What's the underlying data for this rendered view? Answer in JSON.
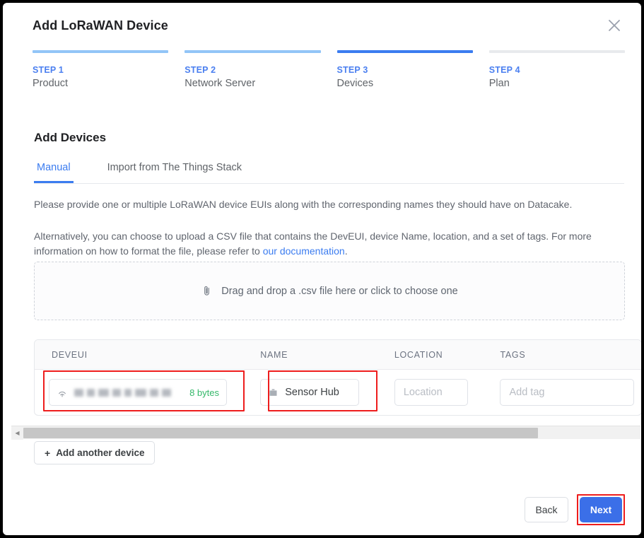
{
  "modal": {
    "title": "Add LoRaWAN Device",
    "close_icon": "close-icon"
  },
  "stepper": {
    "steps": [
      {
        "num": "STEP 1",
        "label": "Product",
        "state": "done"
      },
      {
        "num": "STEP 2",
        "label": "Network Server",
        "state": "done"
      },
      {
        "num": "STEP 3",
        "label": "Devices",
        "state": "active"
      },
      {
        "num": "STEP 4",
        "label": "Plan",
        "state": "inactive"
      }
    ]
  },
  "section": {
    "title": "Add Devices",
    "tabs": [
      {
        "label": "Manual",
        "active": true
      },
      {
        "label": "Import from The Things Stack",
        "active": false
      }
    ],
    "paragraph1": "Please provide one or multiple LoRaWAN device EUIs along with the corresponding names they should have on Datacake.",
    "paragraph2_before": "Alternatively, you can choose to upload a CSV file that contains the DevEUI, device Name, location, and a set of tags. For more information on how to format the file, please refer to ",
    "paragraph2_link": "our documentation",
    "paragraph2_after": "."
  },
  "dropzone": {
    "icon": "paperclip-icon",
    "text": "Drag and drop a .csv file here or click to choose one"
  },
  "table": {
    "columns": [
      "DEVEUI",
      "NAME",
      "LOCATION",
      "TAGS"
    ],
    "rows": [
      {
        "deveui_icon": "antenna-icon",
        "deveui_value": "",
        "deveui_redacted": true,
        "deveui_bytes": "8 bytes",
        "name_icon": "device-hub-icon",
        "name_value": "Sensor Hub",
        "location_placeholder": "Location",
        "location_value": "",
        "tags_placeholder": "Add tag",
        "tags_value": ""
      }
    ]
  },
  "scrollbar": {
    "left_arrow": "chevron-left-icon",
    "right_arrow": "chevron-right-icon"
  },
  "actions": {
    "add_another": "Add another device",
    "add_another_plus": "+",
    "back": "Back",
    "next": "Next"
  },
  "colors": {
    "accent": "#3b7cf0",
    "step_done": "#92c5f7",
    "step_inactive": "#e8eaed",
    "primary_button": "#3b6fe8",
    "bytes_green": "#35b86a",
    "highlight": "#ee1d1d"
  }
}
